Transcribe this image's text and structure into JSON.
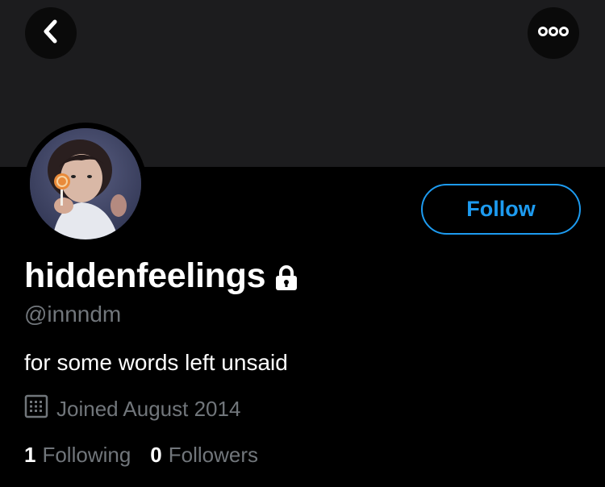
{
  "profile": {
    "display_name": "hiddenfeelings",
    "handle": "@innndm",
    "bio": "for some words left unsaid",
    "joined": "Joined August 2014",
    "protected": true
  },
  "actions": {
    "follow_label": "Follow"
  },
  "stats": {
    "following_count": "1",
    "following_label": "Following",
    "followers_count": "0",
    "followers_label": "Followers"
  },
  "icons": {
    "back": "chevron-left-icon",
    "more": "more-horizontal-icon",
    "lock": "lock-icon",
    "calendar": "calendar-icon"
  },
  "colors": {
    "background": "#000000",
    "banner": "#1c1c1e",
    "accent": "#1d9bf0",
    "secondary_text": "#71767b"
  }
}
